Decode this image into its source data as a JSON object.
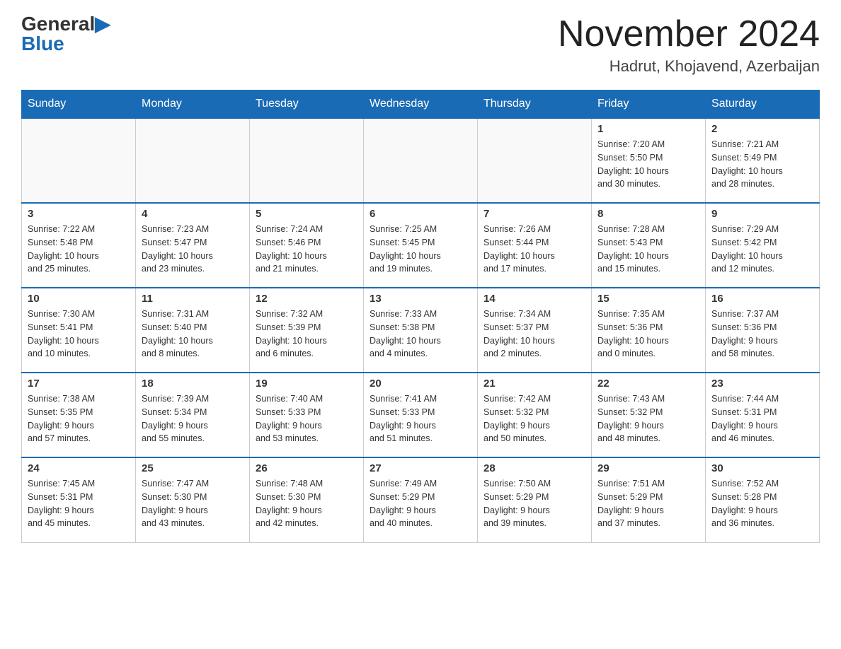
{
  "header": {
    "logo_general": "General",
    "logo_blue": "Blue",
    "month_title": "November 2024",
    "subtitle": "Hadrut, Khojavend, Azerbaijan"
  },
  "days_of_week": [
    "Sunday",
    "Monday",
    "Tuesday",
    "Wednesday",
    "Thursday",
    "Friday",
    "Saturday"
  ],
  "weeks": [
    {
      "days": [
        {
          "number": "",
          "info": ""
        },
        {
          "number": "",
          "info": ""
        },
        {
          "number": "",
          "info": ""
        },
        {
          "number": "",
          "info": ""
        },
        {
          "number": "",
          "info": ""
        },
        {
          "number": "1",
          "info": "Sunrise: 7:20 AM\nSunset: 5:50 PM\nDaylight: 10 hours\nand 30 minutes."
        },
        {
          "number": "2",
          "info": "Sunrise: 7:21 AM\nSunset: 5:49 PM\nDaylight: 10 hours\nand 28 minutes."
        }
      ]
    },
    {
      "days": [
        {
          "number": "3",
          "info": "Sunrise: 7:22 AM\nSunset: 5:48 PM\nDaylight: 10 hours\nand 25 minutes."
        },
        {
          "number": "4",
          "info": "Sunrise: 7:23 AM\nSunset: 5:47 PM\nDaylight: 10 hours\nand 23 minutes."
        },
        {
          "number": "5",
          "info": "Sunrise: 7:24 AM\nSunset: 5:46 PM\nDaylight: 10 hours\nand 21 minutes."
        },
        {
          "number": "6",
          "info": "Sunrise: 7:25 AM\nSunset: 5:45 PM\nDaylight: 10 hours\nand 19 minutes."
        },
        {
          "number": "7",
          "info": "Sunrise: 7:26 AM\nSunset: 5:44 PM\nDaylight: 10 hours\nand 17 minutes."
        },
        {
          "number": "8",
          "info": "Sunrise: 7:28 AM\nSunset: 5:43 PM\nDaylight: 10 hours\nand 15 minutes."
        },
        {
          "number": "9",
          "info": "Sunrise: 7:29 AM\nSunset: 5:42 PM\nDaylight: 10 hours\nand 12 minutes."
        }
      ]
    },
    {
      "days": [
        {
          "number": "10",
          "info": "Sunrise: 7:30 AM\nSunset: 5:41 PM\nDaylight: 10 hours\nand 10 minutes."
        },
        {
          "number": "11",
          "info": "Sunrise: 7:31 AM\nSunset: 5:40 PM\nDaylight: 10 hours\nand 8 minutes."
        },
        {
          "number": "12",
          "info": "Sunrise: 7:32 AM\nSunset: 5:39 PM\nDaylight: 10 hours\nand 6 minutes."
        },
        {
          "number": "13",
          "info": "Sunrise: 7:33 AM\nSunset: 5:38 PM\nDaylight: 10 hours\nand 4 minutes."
        },
        {
          "number": "14",
          "info": "Sunrise: 7:34 AM\nSunset: 5:37 PM\nDaylight: 10 hours\nand 2 minutes."
        },
        {
          "number": "15",
          "info": "Sunrise: 7:35 AM\nSunset: 5:36 PM\nDaylight: 10 hours\nand 0 minutes."
        },
        {
          "number": "16",
          "info": "Sunrise: 7:37 AM\nSunset: 5:36 PM\nDaylight: 9 hours\nand 58 minutes."
        }
      ]
    },
    {
      "days": [
        {
          "number": "17",
          "info": "Sunrise: 7:38 AM\nSunset: 5:35 PM\nDaylight: 9 hours\nand 57 minutes."
        },
        {
          "number": "18",
          "info": "Sunrise: 7:39 AM\nSunset: 5:34 PM\nDaylight: 9 hours\nand 55 minutes."
        },
        {
          "number": "19",
          "info": "Sunrise: 7:40 AM\nSunset: 5:33 PM\nDaylight: 9 hours\nand 53 minutes."
        },
        {
          "number": "20",
          "info": "Sunrise: 7:41 AM\nSunset: 5:33 PM\nDaylight: 9 hours\nand 51 minutes."
        },
        {
          "number": "21",
          "info": "Sunrise: 7:42 AM\nSunset: 5:32 PM\nDaylight: 9 hours\nand 50 minutes."
        },
        {
          "number": "22",
          "info": "Sunrise: 7:43 AM\nSunset: 5:32 PM\nDaylight: 9 hours\nand 48 minutes."
        },
        {
          "number": "23",
          "info": "Sunrise: 7:44 AM\nSunset: 5:31 PM\nDaylight: 9 hours\nand 46 minutes."
        }
      ]
    },
    {
      "days": [
        {
          "number": "24",
          "info": "Sunrise: 7:45 AM\nSunset: 5:31 PM\nDaylight: 9 hours\nand 45 minutes."
        },
        {
          "number": "25",
          "info": "Sunrise: 7:47 AM\nSunset: 5:30 PM\nDaylight: 9 hours\nand 43 minutes."
        },
        {
          "number": "26",
          "info": "Sunrise: 7:48 AM\nSunset: 5:30 PM\nDaylight: 9 hours\nand 42 minutes."
        },
        {
          "number": "27",
          "info": "Sunrise: 7:49 AM\nSunset: 5:29 PM\nDaylight: 9 hours\nand 40 minutes."
        },
        {
          "number": "28",
          "info": "Sunrise: 7:50 AM\nSunset: 5:29 PM\nDaylight: 9 hours\nand 39 minutes."
        },
        {
          "number": "29",
          "info": "Sunrise: 7:51 AM\nSunset: 5:29 PM\nDaylight: 9 hours\nand 37 minutes."
        },
        {
          "number": "30",
          "info": "Sunrise: 7:52 AM\nSunset: 5:28 PM\nDaylight: 9 hours\nand 36 minutes."
        }
      ]
    }
  ]
}
